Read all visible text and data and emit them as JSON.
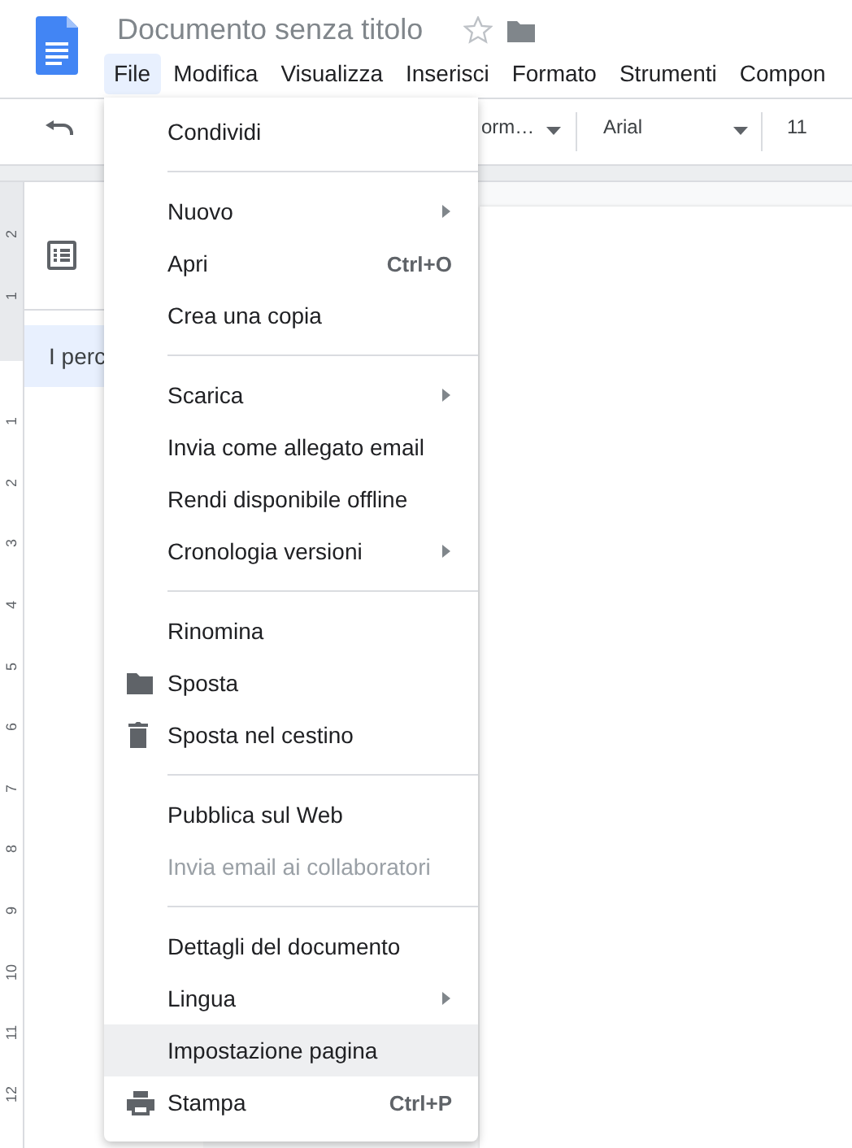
{
  "document": {
    "title": "Documento senza titolo"
  },
  "menubar": [
    {
      "label": "File",
      "selected": true
    },
    {
      "label": "Modifica",
      "selected": false
    },
    {
      "label": "Visualizza",
      "selected": false
    },
    {
      "label": "Inserisci",
      "selected": false
    },
    {
      "label": "Formato",
      "selected": false
    },
    {
      "label": "Strumenti",
      "selected": false
    },
    {
      "label": "Compon",
      "selected": false
    }
  ],
  "toolbar": {
    "style": "orm…",
    "font": "Arial",
    "size": "11"
  },
  "ruler": {
    "labels": [
      "2",
      "1",
      "1",
      "2",
      "3",
      "4",
      "5",
      "6",
      "7",
      "8",
      "9",
      "10",
      "11",
      "12"
    ]
  },
  "outline": {
    "items": [
      {
        "label": "I perc",
        "selected": true
      }
    ]
  },
  "menu": {
    "groups": [
      [
        {
          "label": "Condividi",
          "kind": "plain",
          "submenu": false,
          "disabled": false,
          "highlighted": false
        }
      ],
      [
        {
          "label": "Nuovo",
          "kind": "plain",
          "submenu": true,
          "disabled": false,
          "highlighted": false
        },
        {
          "label": "Apri",
          "kind": "plain",
          "shortcut": "Ctrl+O",
          "submenu": false,
          "disabled": false,
          "highlighted": false
        },
        {
          "label": "Crea una copia",
          "kind": "plain",
          "submenu": false,
          "disabled": false,
          "highlighted": false
        }
      ],
      [
        {
          "label": "Scarica",
          "kind": "plain",
          "submenu": true,
          "disabled": false,
          "highlighted": false
        },
        {
          "label": "Invia come allegato email",
          "kind": "plain",
          "submenu": false,
          "disabled": false,
          "highlighted": false
        },
        {
          "label": "Rendi disponibile offline",
          "kind": "plain",
          "submenu": false,
          "disabled": false,
          "highlighted": false
        },
        {
          "label": "Cronologia versioni",
          "kind": "plain",
          "submenu": true,
          "disabled": false,
          "highlighted": false
        }
      ],
      [
        {
          "label": "Rinomina",
          "kind": "plain",
          "submenu": false,
          "disabled": false,
          "highlighted": false
        },
        {
          "label": "Sposta",
          "kind": "folder",
          "submenu": false,
          "disabled": false,
          "highlighted": false
        },
        {
          "label": "Sposta nel cestino",
          "kind": "trash",
          "submenu": false,
          "disabled": false,
          "highlighted": false
        }
      ],
      [
        {
          "label": "Pubblica sul Web",
          "kind": "plain",
          "submenu": false,
          "disabled": false,
          "highlighted": false
        },
        {
          "label": "Invia email ai collaboratori",
          "kind": "plain",
          "submenu": false,
          "disabled": true,
          "highlighted": false
        }
      ],
      [
        {
          "label": "Dettagli del documento",
          "kind": "plain",
          "submenu": false,
          "disabled": false,
          "highlighted": false
        },
        {
          "label": "Lingua",
          "kind": "plain",
          "submenu": true,
          "disabled": false,
          "highlighted": false
        },
        {
          "label": "Impostazione pagina",
          "kind": "plain",
          "submenu": false,
          "disabled": false,
          "highlighted": true
        },
        {
          "label": "Stampa",
          "kind": "print",
          "shortcut": "Ctrl+P",
          "submenu": false,
          "disabled": false,
          "highlighted": false
        }
      ]
    ]
  }
}
